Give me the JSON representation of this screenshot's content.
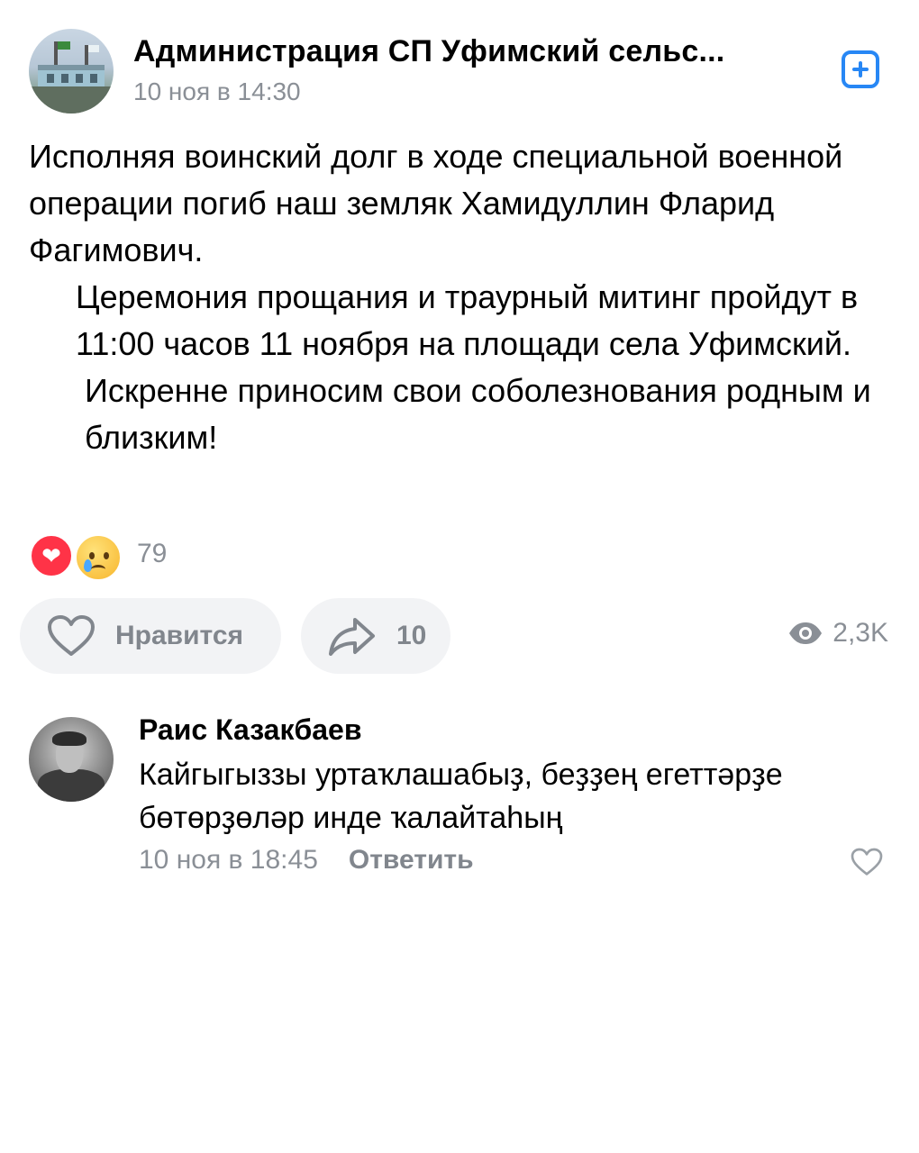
{
  "post": {
    "group_name": "Администрация СП Уфимский сельс...",
    "time": "10 ноя в 14:30",
    "add_icon": "plus-square-icon",
    "paragraphs": [
      "Исполняя воинский долг в ходе специальной военной операции погиб наш земляк Хамидуллин Фларид Фагимович.",
      "Церемония прощания и траурный митинг пройдут в 11:00 часов 11 ноября на площади села Уфимский.",
      "Искренне приносим свои соболезнования родным и близким!"
    ],
    "reactions": {
      "icons": [
        "heart-reaction-icon",
        "crying-face-reaction-icon"
      ],
      "count": "79"
    },
    "actions": {
      "like_label": "Нравится",
      "share_count": "10",
      "views": "2,3K"
    }
  },
  "comment": {
    "author": "Раис Казакбаев",
    "text": "Кайгыгыззы уртаҡлашабыҙ, беҙҙең егеттәрҙе бөтөрҙөләр инде ҡалайтаһың",
    "time": "10 ноя в 18:45",
    "reply_label": "Ответить"
  },
  "colors": {
    "accent": "#2787f5",
    "secondary_text": "#8a8f96",
    "pill_background": "#f2f3f5",
    "heart_reaction": "#ff3347"
  }
}
